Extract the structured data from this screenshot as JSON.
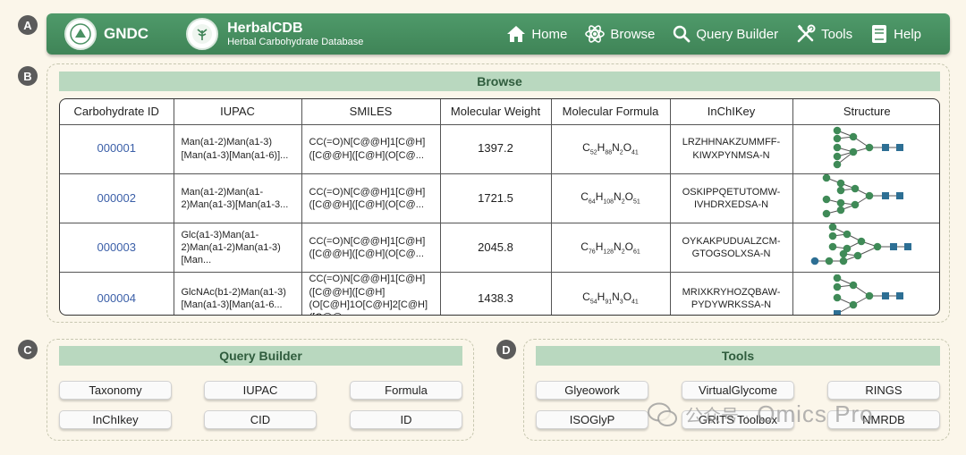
{
  "panels": {
    "a": "A",
    "b": "B",
    "c": "C",
    "d": "D"
  },
  "header": {
    "org_name": "GNDC",
    "db_title": "HerbalCDB",
    "db_subtitle": "Herbal Carbohydrate Database",
    "nav": [
      {
        "label": "Home",
        "icon": "home-icon"
      },
      {
        "label": "Browse",
        "icon": "atom-icon"
      },
      {
        "label": "Query Builder",
        "icon": "search-icon"
      },
      {
        "label": "Tools",
        "icon": "tools-icon"
      },
      {
        "label": "Help",
        "icon": "book-icon"
      }
    ]
  },
  "browse": {
    "title": "Browse",
    "columns": [
      "Carbohydrate ID",
      "IUPAC",
      "SMILES",
      "Molecular Weight",
      "Molecular Formula",
      "InChIKey",
      "Structure"
    ],
    "rows": [
      {
        "id": "000001",
        "iupac": "Man(a1-2)Man(a1-3)[Man(a1-3)[Man(a1-6)]...",
        "smiles": "CC(=O)N[C@@H]1[C@H]([C@@H]([C@H](O[C@...",
        "mw": "1397.2",
        "formula": {
          "c": "52",
          "h": "88",
          "n": "2",
          "o": "41"
        },
        "inchikey": "LRZHHNAKZUMMFF-KIWXPYNMSA-N"
      },
      {
        "id": "000002",
        "iupac": "Man(a1-2)Man(a1-2)Man(a1-3)[Man(a1-3...",
        "smiles": "CC(=O)N[C@@H]1[C@H]([C@@H]([C@H](O[C@...",
        "mw": "1721.5",
        "formula": {
          "c": "64",
          "h": "108",
          "n": "2",
          "o": "51"
        },
        "inchikey": "OSKIPPQETUTOMW-IVHDRXEDSA-N"
      },
      {
        "id": "000003",
        "iupac": "Glc(a1-3)Man(a1-2)Man(a1-2)Man(a1-3)[Man...",
        "smiles": "CC(=O)N[C@@H]1[C@H]([C@@H]([C@H](O[C@...",
        "mw": "2045.8",
        "formula": {
          "c": "76",
          "h": "128",
          "n": "2",
          "o": "61"
        },
        "inchikey": "OYKAKPUDUALZCM-GTOGSOLXSA-N"
      },
      {
        "id": "000004",
        "iupac": "GlcNAc(b1-2)Man(a1-3)[Man(a1-3)[Man(a1-6...",
        "smiles": "CC(=O)N[C@@H]1[C@H]([C@@H]([C@H](O[C@H]1O[C@H]2[C@H]([C@@...",
        "mw": "1438.3",
        "formula": {
          "c": "54",
          "h": "91",
          "n": "3",
          "o": "41"
        },
        "inchikey": "MRIXKRYHOZQBAW-PYDYWRKSSA-N"
      }
    ]
  },
  "query_builder": {
    "title": "Query Builder",
    "buttons": [
      "Taxonomy",
      "IUPAC",
      "Formula",
      "InChIkey",
      "CID",
      "ID"
    ]
  },
  "tools": {
    "title": "Tools",
    "buttons": [
      "Glyeowork",
      "VirtualGlycome",
      "RINGS",
      "ISOGlyP",
      "GRITS Toolbox",
      "NMRDB"
    ]
  },
  "watermark": {
    "cn": "公众号 ·",
    "en": "Omics Pro"
  },
  "colors": {
    "header_green": "#4a9163",
    "section_bar": "#b9d8bf",
    "mannose": "#3f8a57",
    "glcnac": "#2d6f94",
    "link_blue": "#3b5fa8"
  }
}
